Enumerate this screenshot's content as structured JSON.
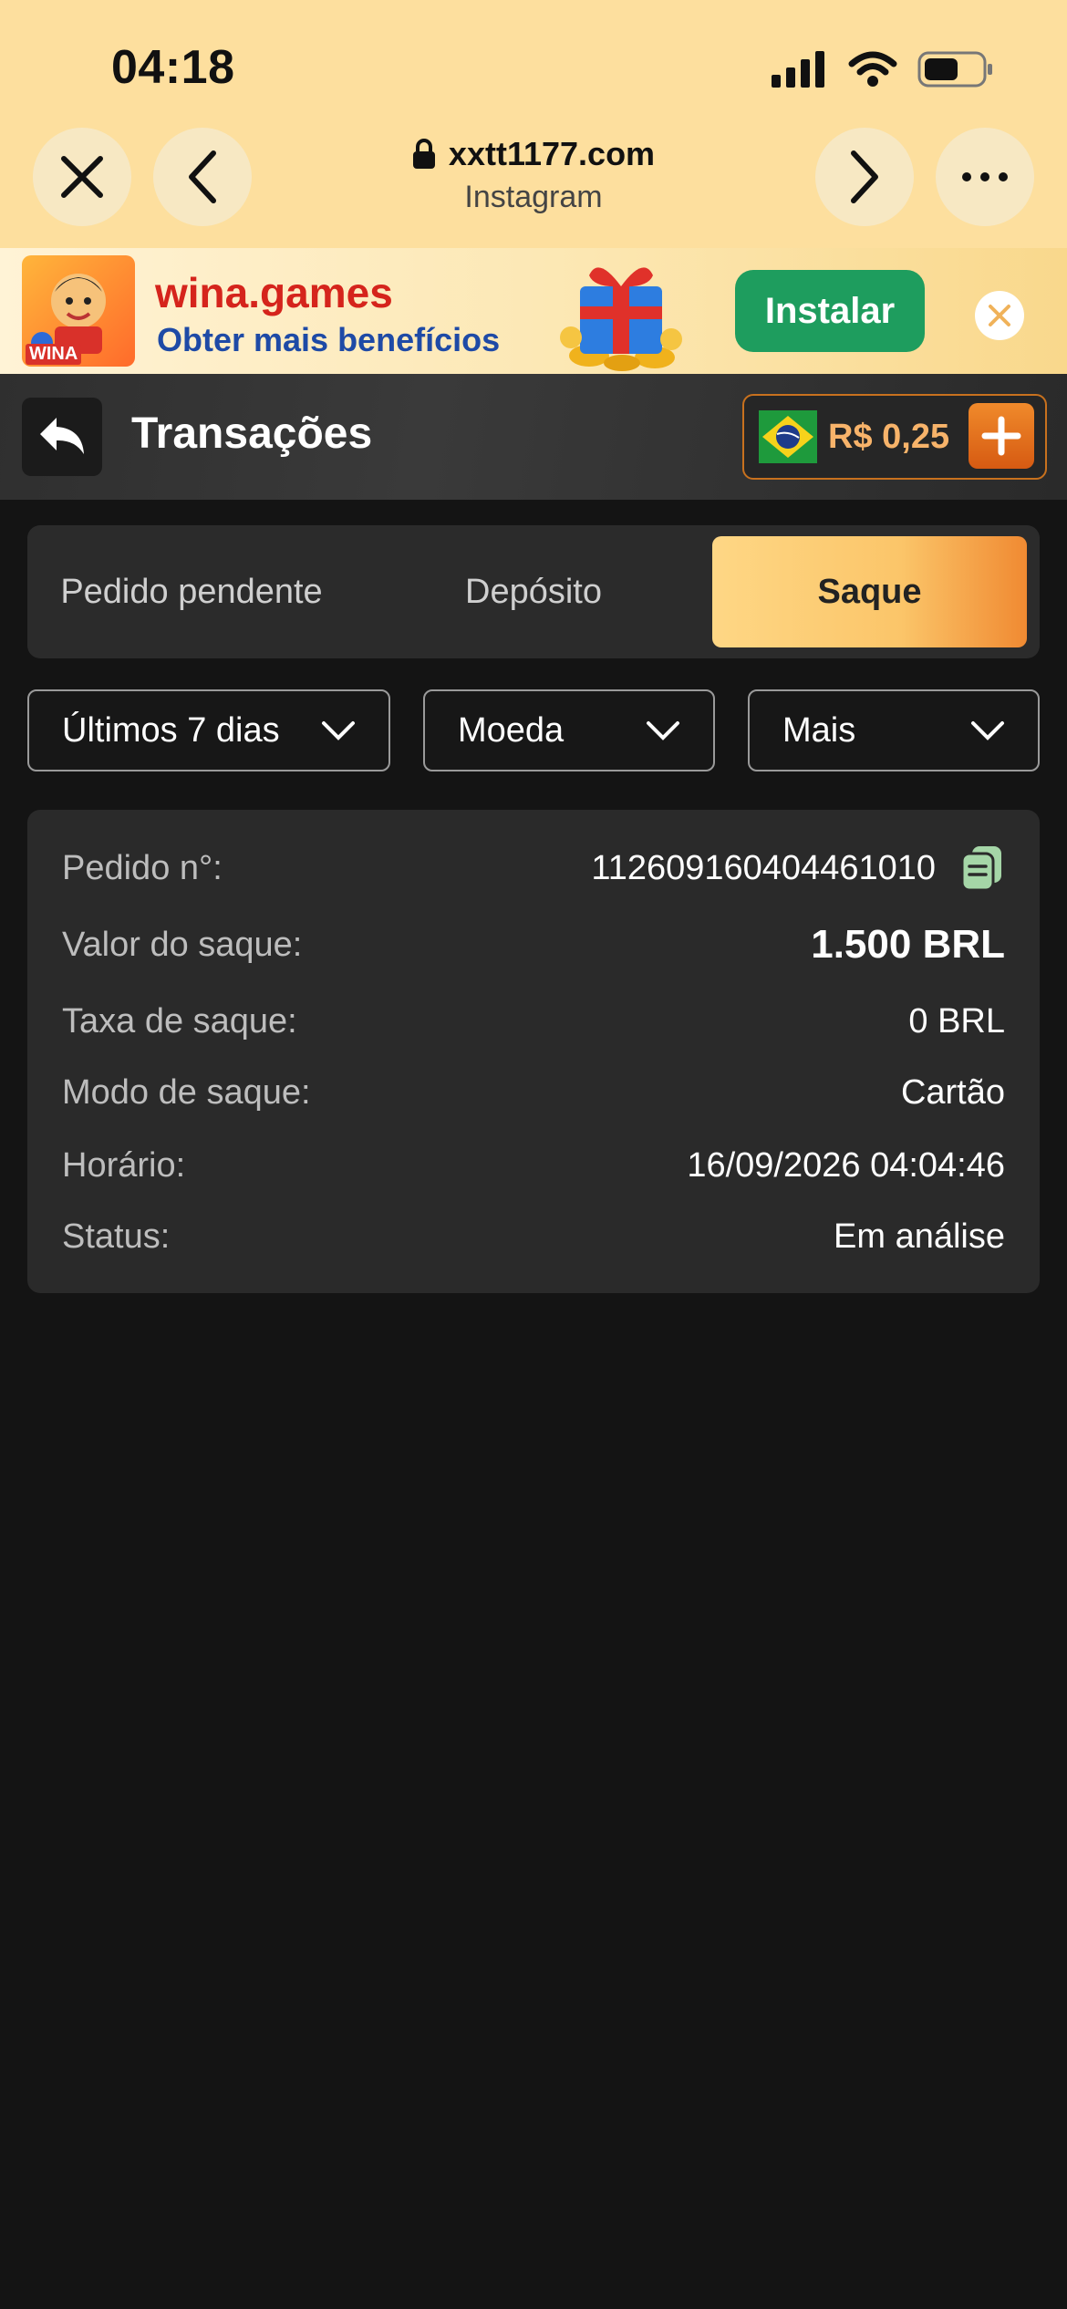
{
  "status_bar": {
    "time": "04:18"
  },
  "browser": {
    "domain": "xxtt1177.com",
    "source": "Instagram"
  },
  "banner": {
    "brand": "wina.games",
    "subtitle": "Obter mais benefícios",
    "logo_text": "WINA",
    "install_label": "Instalar"
  },
  "header": {
    "title": "Transações",
    "balance": "R$ 0,25"
  },
  "tabs": [
    {
      "label": "Pedido pendente",
      "active": false
    },
    {
      "label": "Depósito",
      "active": false
    },
    {
      "label": "Saque",
      "active": true
    }
  ],
  "filters": {
    "period": "Últimos 7 dias",
    "currency": "Moeda",
    "more": "Mais"
  },
  "transaction": {
    "rows": [
      {
        "label": "Pedido n°:",
        "value": "112609160404461010"
      },
      {
        "label": "Valor do saque:",
        "value": "1.500 BRL"
      },
      {
        "label": "Taxa de saque:",
        "value": "0 BRL"
      },
      {
        "label": "Modo de saque:",
        "value": "Cartão"
      },
      {
        "label": "Horário:",
        "value": "16/09/2026 04:04:46"
      },
      {
        "label": "Status:",
        "value": "Em análise"
      }
    ]
  },
  "colors": {
    "accent_orange": "#f08a32",
    "accent_gold": "#fed785",
    "install_green": "#1e9d5e",
    "copy_icon_green": "#a5d6a7"
  }
}
